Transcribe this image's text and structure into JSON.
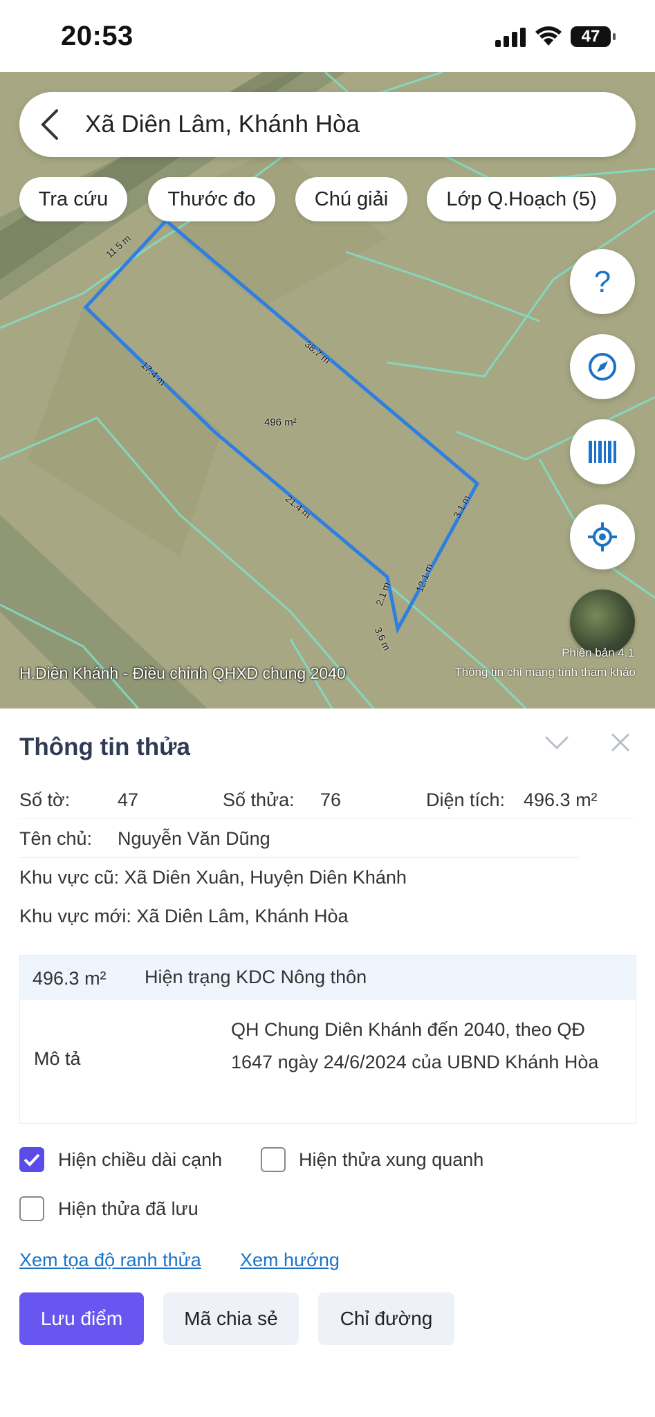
{
  "status_bar": {
    "time": "20:53",
    "battery": "47"
  },
  "search": {
    "location": "Xã Diên Lâm, Khánh Hòa"
  },
  "chips": [
    "Tra cứu",
    "Thước đo",
    "Chú giải",
    "Lớp Q.Hoạch (5)"
  ],
  "map": {
    "edge_labels": [
      "11.5 m",
      "38.7 m",
      "17.4 m",
      "21.4 m",
      "3.1 m",
      "12.1 m",
      "2.1 m",
      "3.6 m"
    ],
    "area_label": "496 m²",
    "plan_label": "H.Diên Khánh - Điều chỉnh QHXD chung 2040",
    "version": "Phiên bản 4.1",
    "notice": "Thông tin chỉ mang tính tham khảo"
  },
  "panel": {
    "title": "Thông tin thửa",
    "so_to_label": "Số tờ:",
    "so_to": "47",
    "so_thua_label": "Số thửa:",
    "so_thua": "76",
    "dien_tich_label": "Diện tích:",
    "dien_tich": "496.3 m²",
    "ten_chu_label": "Tên chủ:",
    "ten_chu": "Nguyễn Văn Dũng",
    "khu_vuc_cu": "Khu vực cũ: Xã Diên Xuân, Huyện Diên Khánh",
    "khu_vuc_moi": "Khu vực mới: Xã Diên Lâm, Khánh Hòa",
    "table": {
      "area": "496.3 m²",
      "status": "Hiện trạng KDC Nông thôn",
      "desc_label": "Mô tả",
      "desc": "QH Chung Diên Khánh đến 2040, theo QĐ 1647 ngày 24/6/2024 của UBND Khánh Hòa"
    },
    "options": {
      "show_edge_length": "Hiện chiều dài cạnh",
      "show_neighbors": "Hiện thửa xung quanh",
      "show_saved": "Hiện thửa đã lưu"
    },
    "links": {
      "coords": "Xem tọa độ ranh thửa",
      "direction": "Xem hướng"
    },
    "buttons": {
      "save": "Lưu điểm",
      "share": "Mã chia sẻ",
      "route": "Chỉ đường"
    }
  },
  "colors": {
    "accent": "#6757f0",
    "link": "#1a73c9",
    "parcel": "#2e7fe0",
    "map_bg": "#a7a883"
  }
}
